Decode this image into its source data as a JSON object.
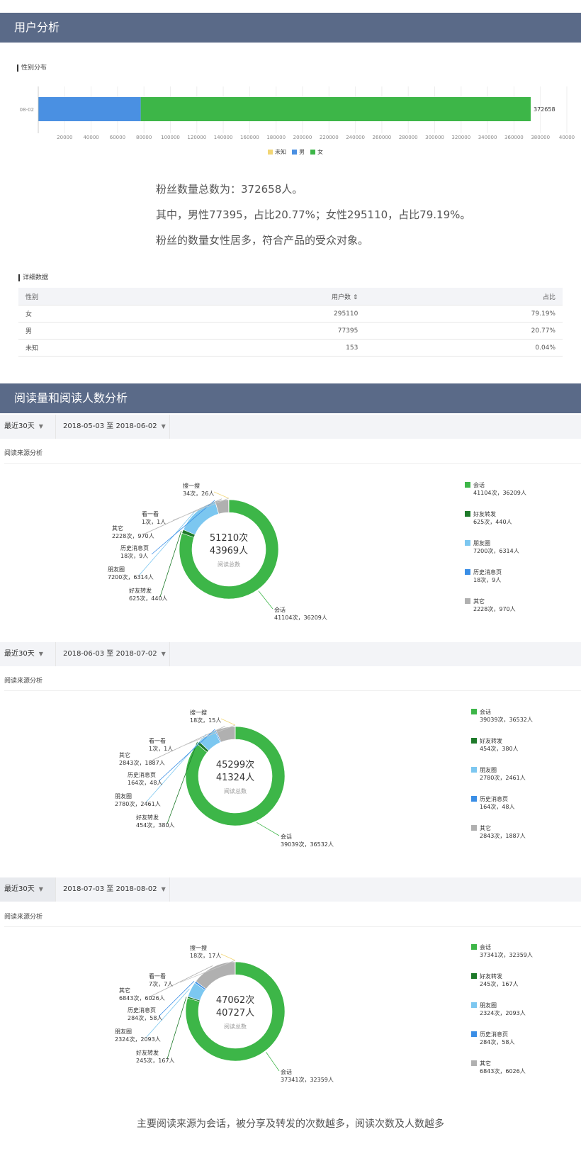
{
  "section1": {
    "header": "用户分析",
    "gender_chart_title": "性别分布",
    "gender_legend": [
      {
        "name": "未知",
        "color": "#f2d675"
      },
      {
        "name": "男",
        "color": "#4a90e2"
      },
      {
        "name": "女",
        "color": "#3db648"
      }
    ],
    "summary_lines": [
      "粉丝数量总数为：372658人。",
      "其中，男性77395，占比20.77%；女性295110，占比79.19%。",
      "粉丝的数量女性居多，符合产品的受众对象。"
    ],
    "detail_title": "详细数据",
    "table": {
      "headers": [
        "性别",
        "用户数 ⇕",
        "占比"
      ],
      "rows": [
        [
          "女",
          "295110",
          "79.19%"
        ],
        [
          "男",
          "77395",
          "20.77%"
        ],
        [
          "未知",
          "153",
          "0.04%"
        ]
      ]
    }
  },
  "section2": {
    "header": "阅读量和阅读人数分析",
    "range_label": "最近30天",
    "subtitle": "阅读来源分析",
    "center_caption": "阅读总数",
    "conclusion": "主要阅读来源为会话，被分享及转发的次数越多，阅读次数及人数越多"
  },
  "chart_data": [
    {
      "type": "bar",
      "orientation": "horizontal",
      "stacked": true,
      "categories": [
        "08-02"
      ],
      "series": [
        {
          "name": "未知",
          "values": [
            153
          ],
          "color": "#f2d675"
        },
        {
          "name": "男",
          "values": [
            77395
          ],
          "color": "#4a90e2"
        },
        {
          "name": "女",
          "values": [
            295110
          ],
          "color": "#3db648"
        }
      ],
      "total_label": "372658",
      "xlim": [
        0,
        400000
      ],
      "xticks": [
        "20000",
        "40000",
        "60000",
        "80000",
        "100000",
        "120000",
        "140000",
        "160000",
        "180000",
        "200000",
        "220000",
        "240000",
        "260000",
        "280000",
        "300000",
        "320000",
        "340000",
        "360000",
        "380000",
        "40000"
      ],
      "grid": true,
      "legend": "bottom"
    },
    {
      "type": "pie",
      "donut": true,
      "date_range": "2018-05-03 至 2018-06-02",
      "center_line1": "51210次",
      "center_line2": "43969人",
      "slices": [
        {
          "name": "会话",
          "times": 41104,
          "people": 36209,
          "label": "41104次，36209人",
          "color": "#3db648"
        },
        {
          "name": "好友转发",
          "times": 625,
          "people": 440,
          "label": "625次，440人",
          "color": "#1e7a2a"
        },
        {
          "name": "朋友圈",
          "times": 7200,
          "people": 6314,
          "label": "7200次，6314人",
          "color": "#7cc7f0"
        },
        {
          "name": "历史消息页",
          "times": 18,
          "people": 9,
          "label": "18次，9人",
          "color": "#3a8ee6"
        },
        {
          "name": "其它",
          "times": 2228,
          "people": 970,
          "label": "2228次，970人",
          "color": "#b0b0b0"
        },
        {
          "name": "看一看",
          "times": 1,
          "people": 1,
          "label": "1次，1人",
          "color": "#c9c9c9"
        },
        {
          "name": "搜一搜",
          "times": 34,
          "people": 26,
          "label": "34次，26人",
          "color": "#f2d675"
        }
      ],
      "legend": "right"
    },
    {
      "type": "pie",
      "donut": true,
      "date_range": "2018-06-03 至 2018-07-02",
      "center_line1": "45299次",
      "center_line2": "41324人",
      "slices": [
        {
          "name": "会话",
          "times": 39039,
          "people": 36532,
          "label": "39039次，36532人",
          "color": "#3db648"
        },
        {
          "name": "好友转发",
          "times": 454,
          "people": 380,
          "label": "454次，380人",
          "color": "#1e7a2a"
        },
        {
          "name": "朋友圈",
          "times": 2780,
          "people": 2461,
          "label": "2780次，2461人",
          "color": "#7cc7f0"
        },
        {
          "name": "历史消息页",
          "times": 164,
          "people": 48,
          "label": "164次，48人",
          "color": "#3a8ee6"
        },
        {
          "name": "其它",
          "times": 2843,
          "people": 1887,
          "label": "2843次，1887人",
          "color": "#b0b0b0"
        },
        {
          "name": "看一看",
          "times": 1,
          "people": 1,
          "label": "1次，1人",
          "color": "#c9c9c9"
        },
        {
          "name": "搜一搜",
          "times": 18,
          "people": 15,
          "label": "18次，15人",
          "color": "#f2d675"
        }
      ],
      "legend": "right"
    },
    {
      "type": "pie",
      "donut": true,
      "date_range": "2018-07-03 至 2018-08-02",
      "center_line1": "47062次",
      "center_line2": "40727人",
      "slices": [
        {
          "name": "会话",
          "times": 37341,
          "people": 32359,
          "label": "37341次，32359人",
          "color": "#3db648"
        },
        {
          "name": "好友转发",
          "times": 245,
          "people": 167,
          "label": "245次，167人",
          "color": "#1e7a2a"
        },
        {
          "name": "朋友圈",
          "times": 2324,
          "people": 2093,
          "label": "2324次，2093人",
          "color": "#7cc7f0"
        },
        {
          "name": "历史消息页",
          "times": 284,
          "people": 58,
          "label": "284次，58人",
          "color": "#3a8ee6"
        },
        {
          "name": "其它",
          "times": 6843,
          "people": 6026,
          "label": "6843次，6026人",
          "color": "#b0b0b0"
        },
        {
          "name": "看一看",
          "times": 7,
          "people": 7,
          "label": "7次，7人",
          "color": "#c9c9c9"
        },
        {
          "name": "搜一搜",
          "times": 18,
          "people": 17,
          "label": "18次，17人",
          "color": "#f2d675"
        }
      ],
      "legend": "right"
    }
  ]
}
